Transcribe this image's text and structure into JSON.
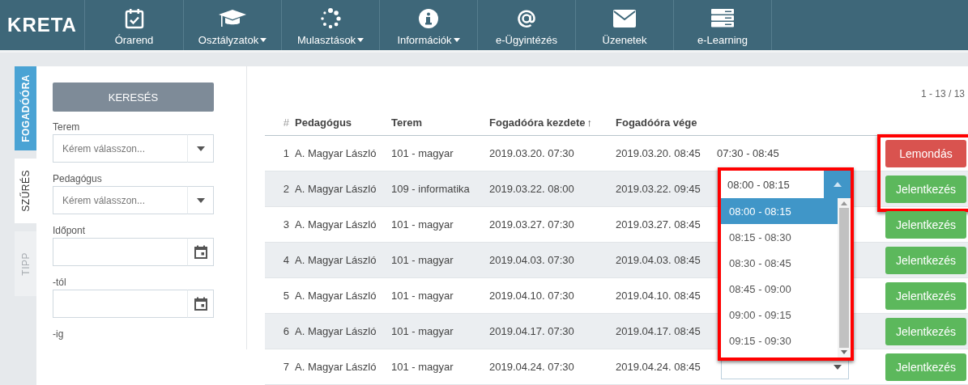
{
  "logo": "KRETA",
  "nav": [
    {
      "label": "Órarend",
      "kind": "calendar",
      "dropdown": false
    },
    {
      "label": "Osztályzatok",
      "kind": "cap",
      "dropdown": true
    },
    {
      "label": "Mulasztások",
      "kind": "dots",
      "dropdown": true
    },
    {
      "label": "Információk",
      "kind": "info",
      "dropdown": true
    },
    {
      "label": "e-Ügyintézés",
      "kind": "at",
      "dropdown": false
    },
    {
      "label": "Üzenetek",
      "kind": "mail",
      "dropdown": false
    },
    {
      "label": "e-Learning",
      "kind": "server",
      "dropdown": false
    }
  ],
  "side_tabs": [
    {
      "label": "FOGADÓÓRA",
      "kind": "primary",
      "selected": false
    },
    {
      "label": "SZŰRÉS",
      "kind": "normal",
      "selected": true
    },
    {
      "label": "TIPP",
      "kind": "disabled",
      "selected": false
    }
  ],
  "filter": {
    "search_button": "KERESÉS",
    "fields": [
      {
        "label": "Terem",
        "kind": "select",
        "placeholder": "Kérem válasszon..."
      },
      {
        "label": "Pedagógus",
        "kind": "select",
        "placeholder": "Kérem válasszon..."
      },
      {
        "label": "Időpont",
        "kind": "date"
      },
      {
        "label": "-tól",
        "kind": "date"
      },
      {
        "label": "-ig",
        "kind": "label"
      }
    ]
  },
  "table": {
    "pagination": "1 - 13 / 13",
    "columns": [
      {
        "label": "#"
      },
      {
        "label": "Pedagógus"
      },
      {
        "label": "Terem"
      },
      {
        "label": "Fogadóóra kezdete",
        "sort_indicator": "↑"
      },
      {
        "label": "Fogadóóra vége"
      }
    ],
    "rows": [
      {
        "number": "1",
        "teacher": "A. Magyar László",
        "room": "101 - magyar",
        "start": "2019.03.20. 07:30",
        "end": "2019.03.20. 08:45",
        "slot": {
          "kind": "text",
          "value": "07:30 - 08:45"
        },
        "action": {
          "kind": "cancel",
          "label": "Lemondás"
        }
      },
      {
        "number": "2",
        "teacher": "A. Magyar László",
        "room": "109 - informatika",
        "start": "2019.03.22. 08:00",
        "end": "2019.03.22. 09:45",
        "slot": {
          "kind": "select",
          "value": "08:00 - 08:15",
          "expanded": true
        },
        "action": {
          "kind": "apply",
          "label": "Jelentkezés"
        }
      },
      {
        "number": "3",
        "teacher": "A. Magyar László",
        "room": "101 - magyar",
        "start": "2019.03.27. 07:30",
        "end": "2019.03.27. 08:45",
        "slot": {
          "kind": "hidden"
        },
        "action": {
          "kind": "apply",
          "label": "Jelentkezés"
        }
      },
      {
        "number": "4",
        "teacher": "A. Magyar László",
        "room": "101 - magyar",
        "start": "2019.04.03. 07:30",
        "end": "2019.04.03. 08:45",
        "slot": {
          "kind": "hidden"
        },
        "action": {
          "kind": "apply",
          "label": "Jelentkezés"
        }
      },
      {
        "number": "5",
        "teacher": "A. Magyar László",
        "room": "101 - magyar",
        "start": "2019.04.10. 07:30",
        "end": "2019.04.10. 08:45",
        "slot": {
          "kind": "hidden"
        },
        "action": {
          "kind": "apply",
          "label": "Jelentkezés"
        }
      },
      {
        "number": "6",
        "teacher": "A. Magyar László",
        "room": "101 - magyar",
        "start": "2019.04.17. 07:30",
        "end": "2019.04.17. 08:45",
        "slot": {
          "kind": "hidden"
        },
        "action": {
          "kind": "apply",
          "label": "Jelentkezés"
        }
      },
      {
        "number": "7",
        "teacher": "A. Magyar László",
        "room": "101 - magyar",
        "start": "2019.04.24. 07:30",
        "end": "2019.04.24. 08:45",
        "slot": {
          "kind": "select",
          "expanded": false
        },
        "action": {
          "kind": "apply",
          "label": "Jelentkezés"
        }
      }
    ],
    "dropdown_options": [
      {
        "label": "08:00 - 08:15",
        "selected": true
      },
      {
        "label": "08:15 - 08:30",
        "selected": false
      },
      {
        "label": "08:30 - 08:45",
        "selected": false
      },
      {
        "label": "08:45 - 09:00",
        "selected": false
      },
      {
        "label": "09:00 - 09:15",
        "selected": false
      },
      {
        "label": "09:15 - 09:30",
        "selected": false
      }
    ]
  }
}
